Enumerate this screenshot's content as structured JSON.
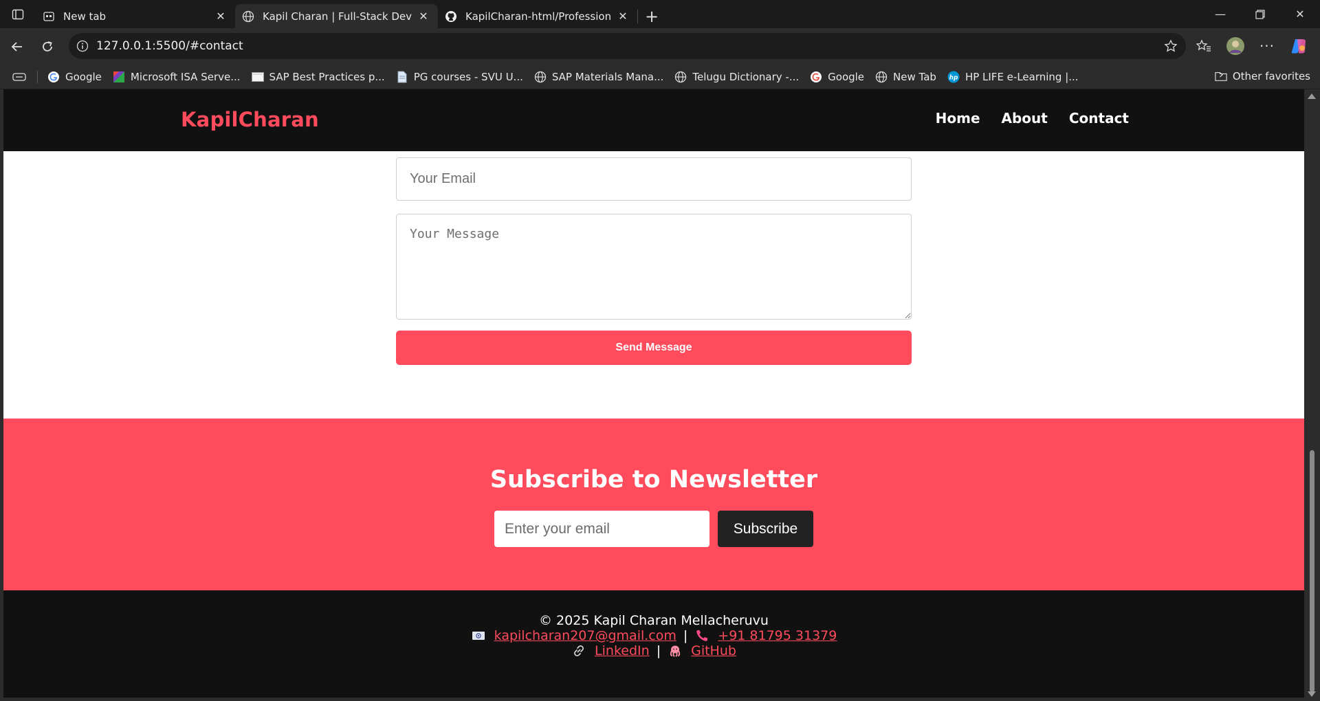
{
  "browser": {
    "tabs": [
      {
        "title": "New tab",
        "active": false
      },
      {
        "title": "Kapil Charan | Full-Stack Developer",
        "active": true
      },
      {
        "title": "KapilCharan-html/Professional-Landing",
        "active": false
      }
    ],
    "url": "127.0.0.1:5500/#contact",
    "bookmarks": [
      {
        "label": "Google",
        "icon": "google-icon"
      },
      {
        "label": "Microsoft ISA Serve...",
        "icon": "isa-icon"
      },
      {
        "label": "SAP Best Practices p...",
        "icon": "page-icon"
      },
      {
        "label": "PG courses - SVU U...",
        "icon": "doc-icon"
      },
      {
        "label": "SAP Materials Mana...",
        "icon": "globe-icon"
      },
      {
        "label": "Telugu Dictionary -...",
        "icon": "globe-icon"
      },
      {
        "label": "Google",
        "icon": "google-icon"
      },
      {
        "label": "New Tab",
        "icon": "globe-icon"
      },
      {
        "label": "HP LIFE e-Learning |...",
        "icon": "hp-icon"
      }
    ],
    "other_favorites": "Other favorites"
  },
  "site": {
    "logo": "KapilCharan",
    "nav": [
      "Home",
      "About",
      "Contact"
    ],
    "contact": {
      "email_placeholder": "Your Email",
      "message_placeholder": "Your Message",
      "send_label": "Send Message"
    },
    "newsletter": {
      "title": "Subscribe to Newsletter",
      "email_placeholder": "Enter your email",
      "button_label": "Subscribe"
    },
    "footer": {
      "copyright": "© 2025 Kapil Charan Mellacheruvu",
      "email": "kapilcharan207@gmail.com",
      "phone": "+91 81795 31379",
      "linkedin": "LinkedIn",
      "github": "GitHub"
    }
  },
  "colors": {
    "accent": "#ff4b5c",
    "header_bg": "#111111",
    "chrome_bg": "#2c2c2c"
  }
}
